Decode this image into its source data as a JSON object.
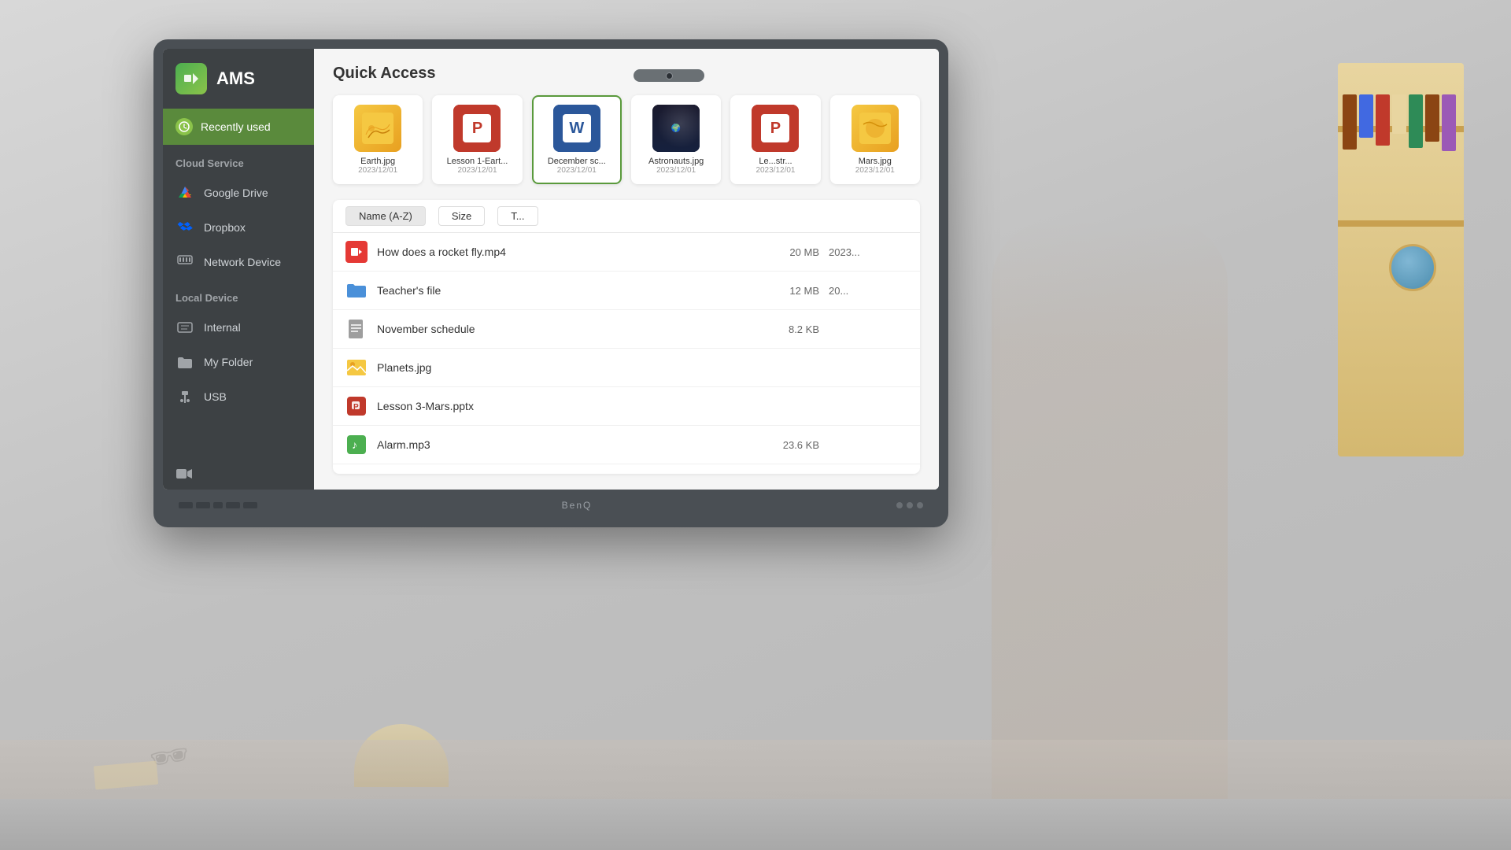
{
  "app": {
    "title": "AMS",
    "camera_brand": "BenQ"
  },
  "sidebar": {
    "ams_icon": "📁",
    "recently_used_label": "Recently used",
    "cloud_service_label": "Cloud Service",
    "local_device_label": "Local Device",
    "items": [
      {
        "id": "google-drive",
        "label": "Google Drive",
        "icon": "gdrive"
      },
      {
        "id": "dropbox",
        "label": "Dropbox",
        "icon": "dropbox"
      },
      {
        "id": "network-device",
        "label": "Network Device",
        "icon": "network"
      },
      {
        "id": "internal",
        "label": "Internal",
        "icon": "internal"
      },
      {
        "id": "my-folder",
        "label": "My Folder",
        "icon": "folder"
      },
      {
        "id": "usb",
        "label": "USB",
        "icon": "usb"
      }
    ]
  },
  "quick_access": {
    "title": "Quick Access",
    "files": [
      {
        "name": "Earth.jpg",
        "date": "2023/12/01",
        "type": "image",
        "selected": false
      },
      {
        "name": "Lesson 1-Eart...",
        "date": "2023/12/01",
        "type": "ppt",
        "selected": false
      },
      {
        "name": "December sc...",
        "date": "2023/12/01",
        "type": "word",
        "selected": true
      },
      {
        "name": "Astronauts.jpg",
        "date": "2023/12/01",
        "type": "photo",
        "selected": false
      },
      {
        "name": "Le...str...",
        "date": "2023/12/01",
        "type": "ppt",
        "selected": false
      },
      {
        "name": "Mars.jpg",
        "date": "2023/12/01",
        "type": "image",
        "selected": false
      }
    ]
  },
  "file_list": {
    "columns": {
      "name": "Name (A-Z)",
      "size": "Size",
      "type": "T..."
    },
    "files": [
      {
        "name": "How does a rocket fly.mp4",
        "size": "20 MB",
        "date": "2023...",
        "type": "video"
      },
      {
        "name": "Teacher's file",
        "size": "12 MB",
        "date": "20...",
        "type": "folder"
      },
      {
        "name": "November schedule",
        "size": "8.2 KB",
        "date": "",
        "type": "doc"
      },
      {
        "name": "Planets.jpg",
        "size": "",
        "date": "",
        "type": "image"
      },
      {
        "name": "Lesson 3-Mars.pptx",
        "size": "",
        "date": "",
        "type": "ppt"
      },
      {
        "name": "Alarm.mp3",
        "size": "23.6 KB",
        "date": "",
        "type": "audio"
      }
    ]
  }
}
